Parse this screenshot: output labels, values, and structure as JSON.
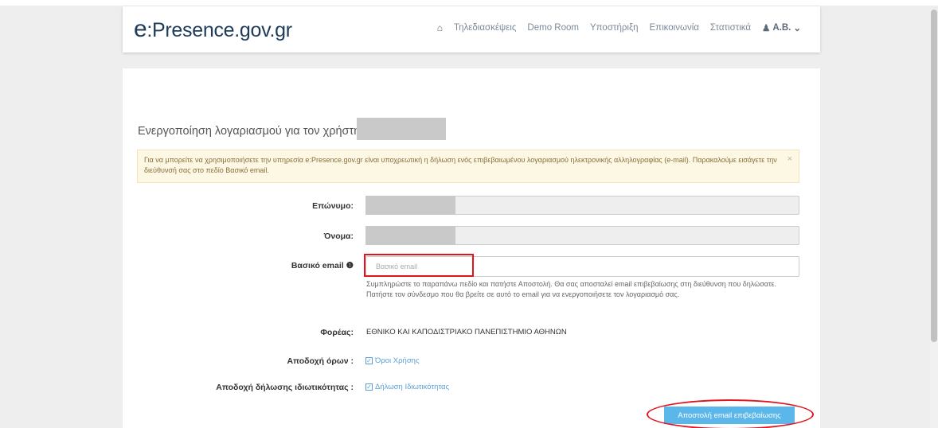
{
  "header": {
    "brand_e": "e",
    "brand_rest": ":Presence.gov.gr",
    "nav": [
      "Τηλεδιασκέψεις",
      "Demo Room",
      "Υποστήριξη",
      "Επικοινωνία",
      "Στατιστικά"
    ],
    "user": "A.B."
  },
  "main": {
    "title": "Ενεργοποίηση λογαριασμού για τον χρήστη:",
    "alert": "Για να μπορείτε να χρησιμοποιήσετε την υπηρεσία e:Presence.gov.gr είναι υποχρεωτική η δήλωση ενός επιβεβαιωμένου λογαριασμού ηλεκτρονικής αλληλογραφίας (e-mail). Παρακαλούμε εισάγετε την διεύθυνσή σας στο πεδίο Βασικό email.",
    "alert_close": "×",
    "surname_label": "Επώνυμο:",
    "name_label": "Όνομα:",
    "email_label": "Βασικό email",
    "email_placeholder": "Βασικό email",
    "email_value": "",
    "email_help": "Συμπληρώστε το παραπάνω πεδίο και πατήστε Αποστολή. Θα σας αποσταλεί email επιβεβαίωσης στη διεύθυνση που δηλώσατε. Πατήστε τον σύνδεσμο που θα βρείτε σε αυτό το email για να ενεργοποιήσετε τον λογαριασμό σας.",
    "org_label": "Φορέας:",
    "org_value": "ΕΘΝΙΚΟ ΚΑΙ ΚΑΠΟΔΙΣΤΡΙΑΚΟ ΠΑΝΕΠΙΣΤΗΜΙΟ ΑΘΗΝΩΝ",
    "terms_label": "Αποδοχή όρων :",
    "terms_link": "Όροι Χρήσης",
    "privacy_label": "Αποδοχή δήλωσης ιδιωτικότητας :",
    "privacy_link": "Δήλωση Ιδιωτικότητας",
    "submit_label": "Αποστολή email επιβεβαίωσης"
  },
  "colors": {
    "brand": "#1e3c5a",
    "link": "#5aa0d6",
    "button": "#5bb7ea",
    "alert_bg": "#fcf8e3",
    "annotation": "#e0141e"
  }
}
